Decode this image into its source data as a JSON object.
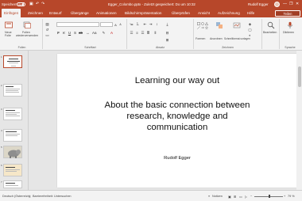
{
  "titlebar": {
    "autosave_label": "Speichern",
    "autosave_state": "Aus",
    "document_title": "Egger_Colombo.pptx  -  Zuletzt gespeichert: Do um 10:32",
    "user_name": "Rudolf Egger",
    "qa_save_icon": "save-icon",
    "qa_undo_icon": "undo-icon",
    "qa_redo_icon": "redo-icon",
    "minimize_glyph": "—",
    "restore_glyph": "❐",
    "close_glyph": "✕"
  },
  "tabs": [
    "Einfügen",
    "Zeichnen",
    "Entwurf",
    "Übergänge",
    "Animationen",
    "Bildschirmpräsentation",
    "Überprüfen",
    "Ansicht",
    "Aufzeichnung",
    "Hilfe"
  ],
  "active_tab_index": 0,
  "share_label": "Teilen",
  "ribbon": {
    "groups": {
      "folien_label": "Folien",
      "schriftart_label": "Schriftart",
      "absatz_label": "Absatz",
      "zeichnen_label": "Zeichnen",
      "sprache_label": "Sprache"
    },
    "new_slide_label_1": "Neue",
    "new_slide_label_2": "Folie",
    "reuse_label_1": "Folien",
    "reuse_label_2": "wiederverwenden",
    "font_size_value": "",
    "formen_label": "Formen",
    "anordnen_label": "Anordnen",
    "schnellformat_label": "Schnellformat-vorlagen",
    "bearbeiten_label": "Bearbeiten",
    "diktieren_label": "Diktieren",
    "accent_color": "#b7472a"
  },
  "slide": {
    "title": "Learning our way out",
    "subtitle_lines": [
      "About the basic connection between",
      "research, knowledge and",
      "communication"
    ],
    "author": "Rudolf Egger"
  },
  "thumbnails": {
    "numbers": [
      "1",
      "2",
      "3",
      "4",
      "5",
      "6",
      "7"
    ],
    "selected_index": 0
  },
  "statusbar": {
    "language": "Deutsch (Österreich)",
    "accessibility": "Barrierefreiheit: Untersuchen",
    "notes_label": "Notizen",
    "zoom_value": "79 %"
  }
}
